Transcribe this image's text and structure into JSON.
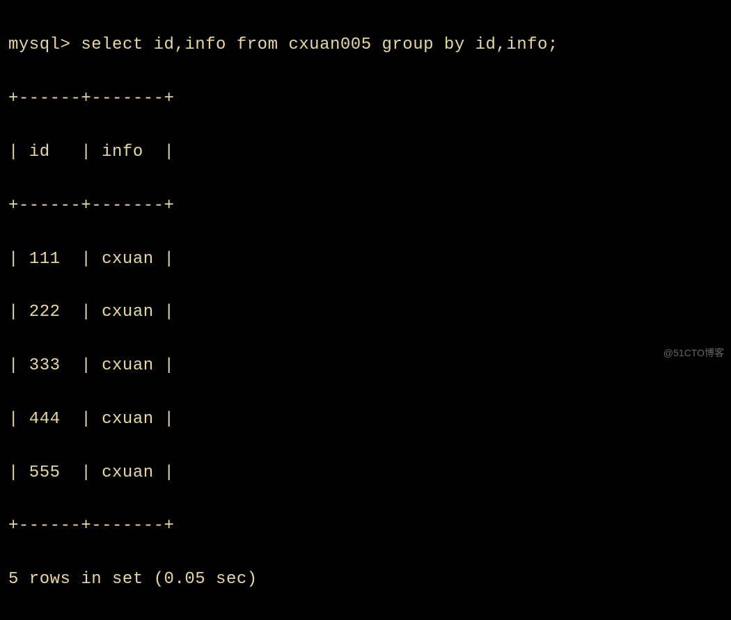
{
  "prompt": "mysql> ",
  "query": "select id,info from cxuan005 group by id,info;",
  "table": {
    "border_top": "+------+-------+",
    "header": "| id   | info  |",
    "border_mid": "+------+-------+",
    "rows": [
      "| 111  | cxuan |",
      "| 222  | cxuan |",
      "| 333  | cxuan |",
      "| 444  | cxuan |",
      "| 555  | cxuan |"
    ],
    "border_bottom": "+------+-------+"
  },
  "result_summary": "5 rows in set (0.05 sec)",
  "watermark": "@51CTO博客",
  "chart_data": {
    "type": "table",
    "columns": [
      "id",
      "info"
    ],
    "rows": [
      {
        "id": 111,
        "info": "cxuan"
      },
      {
        "id": 222,
        "info": "cxuan"
      },
      {
        "id": 333,
        "info": "cxuan"
      },
      {
        "id": 444,
        "info": "cxuan"
      },
      {
        "id": 555,
        "info": "cxuan"
      }
    ],
    "row_count": 5,
    "elapsed_sec": 0.05
  }
}
